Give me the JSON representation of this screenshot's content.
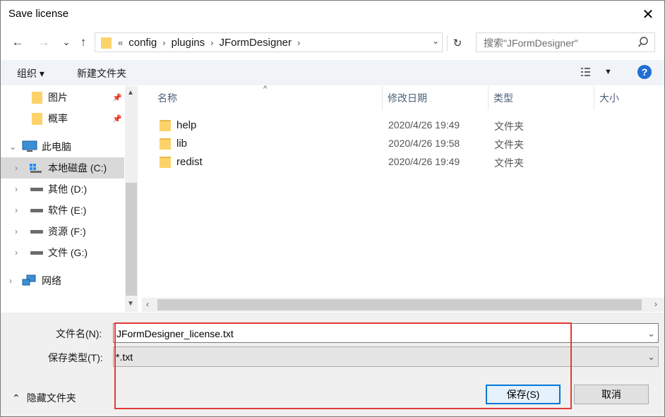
{
  "window": {
    "title": "Save license",
    "close_glyph": "✕"
  },
  "nav": {
    "back": "←",
    "forward": "→",
    "recent": "⌄",
    "up": "↑",
    "breadcrumbs": [
      "config",
      "plugins",
      "JFormDesigner"
    ],
    "overflow": "«",
    "refresh": "↻",
    "search_placeholder": "搜索\"JFormDesigner\""
  },
  "toolbar": {
    "organize": "组织 ▾",
    "new_folder": "新建文件夹",
    "help": "?"
  },
  "sidebar": {
    "items": [
      {
        "label": "图片",
        "icon": "folder-icon",
        "pinned": true
      },
      {
        "label": "概率",
        "icon": "folder-icon",
        "pinned": true
      },
      {
        "label": "此电脑",
        "icon": "computer-icon",
        "expanded": true
      },
      {
        "label": "本地磁盘 (C:)",
        "icon": "drive-icon",
        "selected": true
      },
      {
        "label": "其他 (D:)",
        "icon": "drive-icon"
      },
      {
        "label": "软件 (E:)",
        "icon": "drive-icon"
      },
      {
        "label": "资源 (F:)",
        "icon": "drive-icon"
      },
      {
        "label": "文件 (G:)",
        "icon": "drive-icon"
      },
      {
        "label": "网络",
        "icon": "network-icon"
      }
    ]
  },
  "filelist": {
    "columns": [
      "名称",
      "修改日期",
      "类型",
      "大小"
    ],
    "rows": [
      {
        "name": "help",
        "date": "2020/4/26 19:49",
        "type": "文件夹"
      },
      {
        "name": "lib",
        "date": "2020/4/26 19:58",
        "type": "文件夹"
      },
      {
        "name": "redist",
        "date": "2020/4/26 19:49",
        "type": "文件夹"
      }
    ]
  },
  "form": {
    "filename_label": "文件名(N):",
    "filename_value": "JFormDesigner_license.txt",
    "filetype_label": "保存类型(T):",
    "filetype_value": "*.txt",
    "save_label": "保存(S)",
    "cancel_label": "取消",
    "hide_folders_label": "隐藏文件夹"
  },
  "colors": {
    "accent": "#0078d7",
    "highlight_box": "#e53935",
    "folder": "#fcd36b"
  }
}
